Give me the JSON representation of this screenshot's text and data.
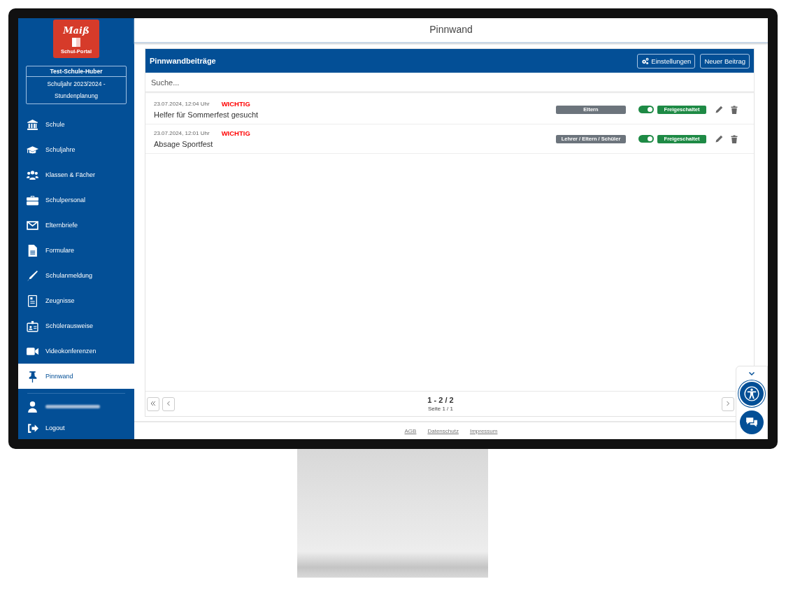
{
  "sidebar": {
    "logo": {
      "wordmark": "Maiß",
      "caption": "Schul-Portal"
    },
    "school": {
      "name": "Test-Schule-Huber",
      "year": "Schuljahr 2023/2024 - Stundenplanung"
    },
    "items": [
      {
        "kind": "bank",
        "label": "Schule",
        "selected": false
      },
      {
        "kind": "cap",
        "label": "Schuljahre",
        "selected": false
      },
      {
        "kind": "users",
        "label": "Klassen & Fächer",
        "selected": false
      },
      {
        "kind": "case",
        "label": "Schulpersonal",
        "selected": false
      },
      {
        "kind": "mail",
        "label": "Elternbriefe",
        "selected": false
      },
      {
        "kind": "file",
        "label": "Formulare",
        "selected": false
      },
      {
        "kind": "pen",
        "label": "Schulanmeldung",
        "selected": false
      },
      {
        "kind": "cert",
        "label": "Zeugnisse",
        "selected": false
      },
      {
        "kind": "badge",
        "label": "Schülerausweise",
        "selected": false
      },
      {
        "kind": "video",
        "label": "Videokonferenzen",
        "selected": false
      },
      {
        "kind": "pin",
        "label": "Pinnwand",
        "selected": true
      }
    ],
    "logout": "Logout"
  },
  "header": {
    "title": "Pinnwand"
  },
  "card": {
    "title": "Pinnwandbeiträge",
    "buttons": [
      {
        "kind": "settings",
        "label": "Einstellungen"
      },
      {
        "kind": "plain",
        "label": "Neuer Beitrag"
      }
    ],
    "search": {
      "placeholder": "Suche..."
    },
    "posts": [
      {
        "date": "23.07.2024, 12:04 Uhr",
        "priority": "WICHTIG",
        "title": "Helfer für Sommerfest gesucht",
        "audience": "Eltern",
        "on": true,
        "status": "Freigeschaltet"
      },
      {
        "date": "23.07.2024, 12:01 Uhr",
        "priority": "WICHTIG",
        "title": "Absage Sportfest",
        "audience": "Lehrer / Eltern / Schüler",
        "on": true,
        "status": "Freigeschaltet"
      }
    ],
    "pagination": {
      "range": "1 - 2 / 2",
      "page": "Seite 1 / 1"
    }
  },
  "footer": {
    "links": [
      "AGB",
      "Datenschutz",
      "Impressum"
    ]
  }
}
